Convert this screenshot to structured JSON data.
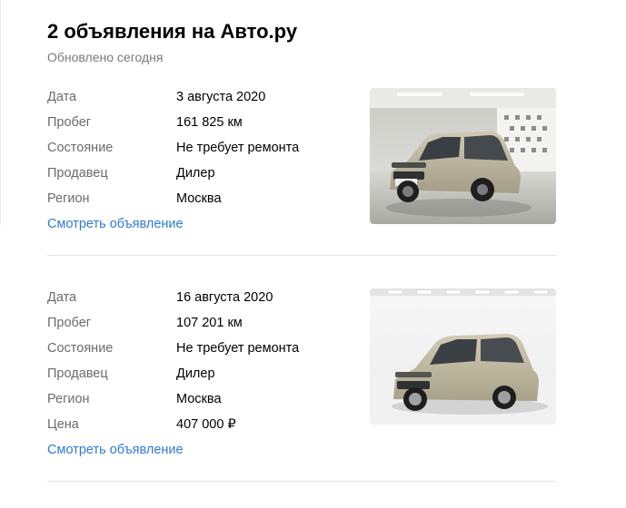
{
  "header": {
    "title": "2 объявления на Авто.ру",
    "subtitle": "Обновлено сегодня"
  },
  "listings": [
    {
      "fields": [
        {
          "label": "Дата",
          "value": "3 августа 2020"
        },
        {
          "label": "Пробег",
          "value": "161 825 км"
        },
        {
          "label": "Состояние",
          "value": "Не требует ремонта"
        },
        {
          "label": "Продавец",
          "value": "Дилер"
        },
        {
          "label": "Регион",
          "value": "Москва"
        }
      ],
      "link": "Смотреть объявление",
      "photo": {
        "background": "showroom-grey",
        "car_color": "#b7b09a"
      }
    },
    {
      "fields": [
        {
          "label": "Дата",
          "value": "16 августа 2020"
        },
        {
          "label": "Пробег",
          "value": "107 201 км"
        },
        {
          "label": "Состояние",
          "value": "Не требует ремонта"
        },
        {
          "label": "Продавец",
          "value": "Дилер"
        },
        {
          "label": "Регион",
          "value": "Москва"
        },
        {
          "label": "Цена",
          "value": "407 000 ₽"
        }
      ],
      "link": "Смотреть объявление",
      "photo": {
        "background": "studio-white",
        "car_color": "#b9b39c"
      }
    }
  ],
  "colors": {
    "link": "#2f7ad6",
    "label": "#6b6b6b",
    "divider": "#e2e2e2"
  }
}
